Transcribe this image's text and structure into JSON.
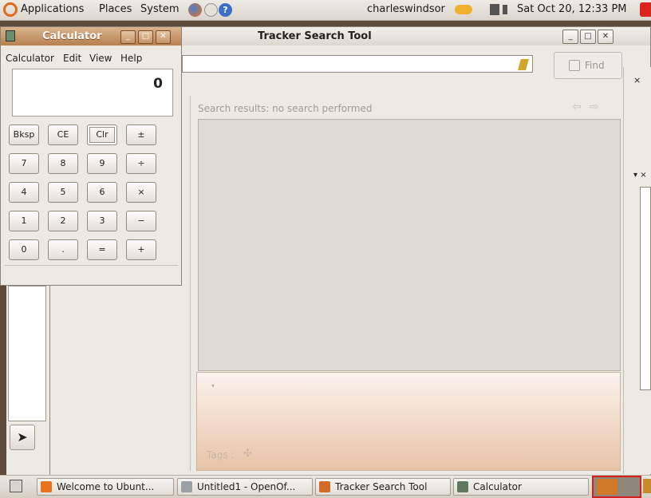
{
  "top_panel": {
    "menus": [
      "Applications",
      "Places",
      "System"
    ],
    "user": "charleswindsor",
    "clock": "Sat Oct 20, 12:33 PM"
  },
  "tracker": {
    "title": "Tracker Search Tool",
    "find_label": "Find",
    "results_label": "Search results: no search performed",
    "tags_label": "Tags :"
  },
  "calculator": {
    "title": "Calculator",
    "menus": [
      "Calculator",
      "Edit",
      "View",
      "Help"
    ],
    "display": "0",
    "rows": [
      [
        "Bksp",
        "CE",
        "Clr",
        "±"
      ],
      [
        "7",
        "8",
        "9",
        "÷"
      ],
      [
        "4",
        "5",
        "6",
        "×"
      ],
      [
        "1",
        "2",
        "3",
        "−"
      ],
      [
        "0",
        ".",
        "=",
        "+"
      ]
    ]
  },
  "taskbar": {
    "tasks": [
      {
        "label": "Welcome to Ubunt...",
        "icon": "firefox-icon",
        "color": "#e8731c"
      },
      {
        "label": "Untitled1 - OpenOf...",
        "icon": "document-icon",
        "color": "#9aa0a6"
      },
      {
        "label": "Tracker Search Tool",
        "icon": "tracker-icon",
        "color": "#d36b28"
      },
      {
        "label": "Calculator",
        "icon": "calculator-icon",
        "color": "#5b7a5e"
      }
    ]
  }
}
